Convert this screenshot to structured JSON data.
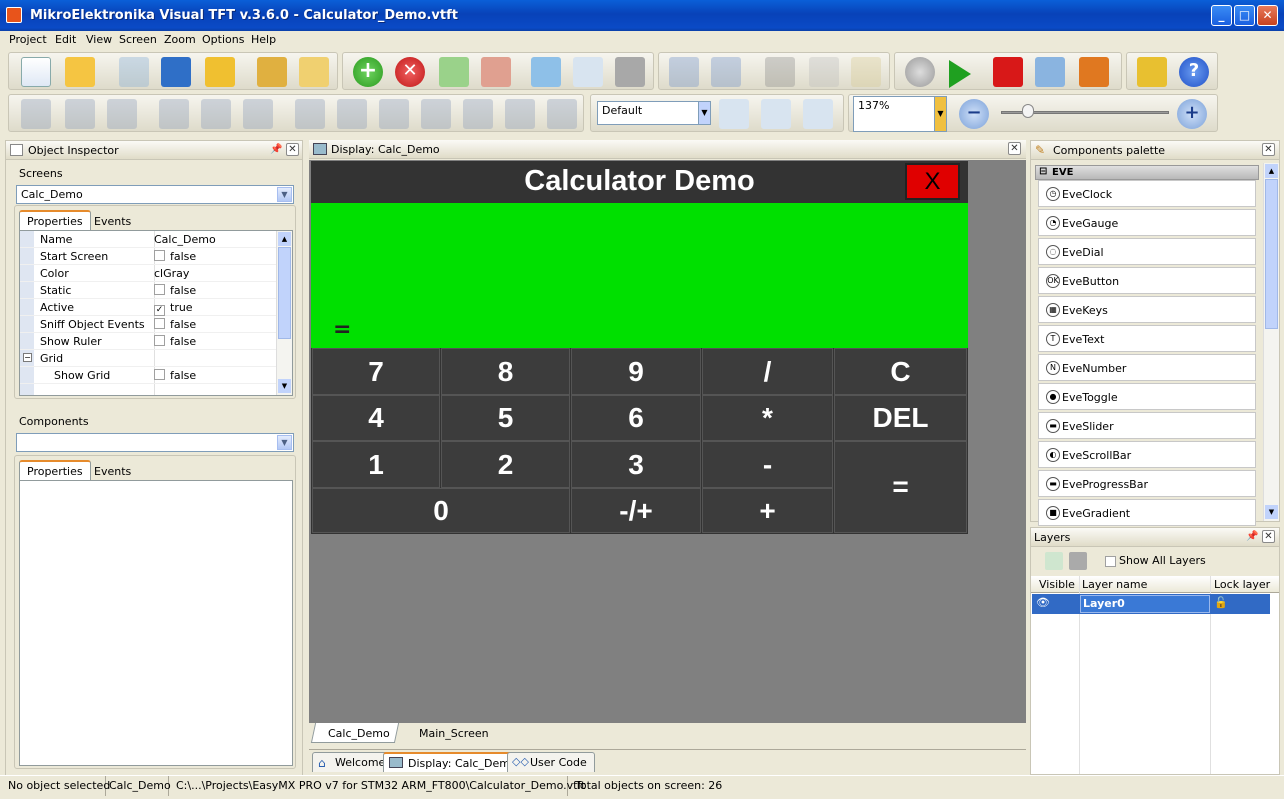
{
  "window": {
    "title": "MikroElektronika Visual TFT v.3.6.0 - Calculator_Demo.vtft"
  },
  "menu": [
    "Project",
    "Edit",
    "View",
    "Screen",
    "Zoom",
    "Options",
    "Help"
  ],
  "toolbar": {
    "style_select": "Default",
    "zoom_select": "137%"
  },
  "object_inspector": {
    "title": "Object Inspector",
    "screens_label": "Screens",
    "screen_select": "Calc_Demo",
    "tabs": [
      "Properties",
      "Events"
    ],
    "properties": [
      {
        "name": "Name",
        "value": "Calc_Demo",
        "checkbox": false
      },
      {
        "name": "Start Screen",
        "value": "false",
        "checkbox": true,
        "checked": false
      },
      {
        "name": "Color",
        "value": "clGray",
        "checkbox": false
      },
      {
        "name": "Static",
        "value": "false",
        "checkbox": true,
        "checked": false
      },
      {
        "name": "Active",
        "value": "true",
        "checkbox": true,
        "checked": true
      },
      {
        "name": "Sniff Object Events",
        "value": "false",
        "checkbox": true,
        "checked": false
      },
      {
        "name": "Show Ruler",
        "value": "false",
        "checkbox": true,
        "checked": false
      },
      {
        "name": "Grid",
        "value": "",
        "checkbox": false,
        "group": true
      },
      {
        "name": "Show Grid",
        "value": "false",
        "checkbox": true,
        "checked": false,
        "indent": true
      }
    ],
    "components_label": "Components",
    "component_select": "",
    "components_tabs": [
      "Properties",
      "Events"
    ]
  },
  "display": {
    "title": "Display: Calc_Demo",
    "calc_title": "Calculator Demo",
    "close_btn": "X",
    "equals_display": "=",
    "keys": [
      "7",
      "8",
      "9",
      "/",
      "C",
      "4",
      "5",
      "6",
      "*",
      "DEL",
      "1",
      "2",
      "3",
      "-",
      "=",
      "0",
      "-/+",
      "+"
    ],
    "screen_tabs": [
      "Calc_Demo",
      "Main_Screen"
    ],
    "doc_tabs": [
      "Welcome",
      "Display: Calc_Demo",
      "User Code"
    ]
  },
  "palette": {
    "title": "Components palette",
    "group": "EVE",
    "items": [
      {
        "label": "EveClock",
        "icon": "clock-icon",
        "glyph": "◷"
      },
      {
        "label": "EveGauge",
        "icon": "gauge-icon",
        "glyph": "◔"
      },
      {
        "label": "EveDial",
        "icon": "dial-icon",
        "glyph": "◌"
      },
      {
        "label": "EveButton",
        "icon": "button-icon",
        "glyph": "OK"
      },
      {
        "label": "EveKeys",
        "icon": "keys-icon",
        "glyph": "▦"
      },
      {
        "label": "EveText",
        "icon": "text-icon",
        "glyph": "T"
      },
      {
        "label": "EveNumber",
        "icon": "number-icon",
        "glyph": "N"
      },
      {
        "label": "EveToggle",
        "icon": "toggle-icon",
        "glyph": "●"
      },
      {
        "label": "EveSlider",
        "icon": "slider-icon",
        "glyph": "▬"
      },
      {
        "label": "EveScrollBar",
        "icon": "scrollbar-icon",
        "glyph": "◐"
      },
      {
        "label": "EveProgressBar",
        "icon": "progressbar-icon",
        "glyph": "▬"
      },
      {
        "label": "EveGradient",
        "icon": "gradient-icon",
        "glyph": "■"
      }
    ]
  },
  "layers": {
    "title": "Layers",
    "show_all": "Show All Layers",
    "columns": [
      "Visible",
      "Layer name",
      "Lock layer"
    ],
    "rows": [
      {
        "name": "Layer0"
      }
    ]
  },
  "statusbar": {
    "selection": "No object selected",
    "screen": "Calc_Demo",
    "path": "C:\\...\\Projects\\EasyMX PRO v7 for STM32 ARM_FT800\\Calculator_Demo.vtft",
    "total": "Total objects on screen: 26"
  },
  "colors": {
    "calc_display": "#00e000",
    "calc_close": "#e00000",
    "layer_selected": "#316ac5"
  }
}
